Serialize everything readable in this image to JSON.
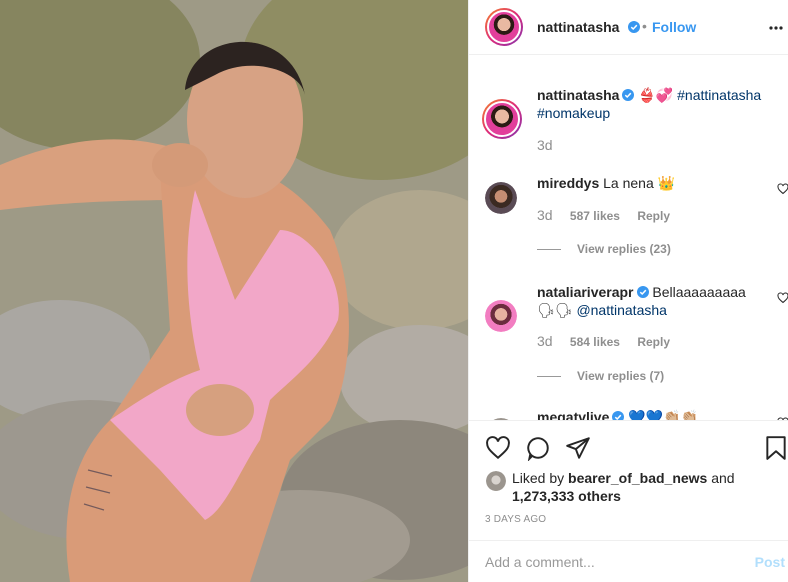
{
  "post": {
    "image_alt": "",
    "author": {
      "username": "nattinatasha",
      "verified": true,
      "follow_label": "Follow",
      "separator": "•"
    }
  },
  "caption": {
    "username": "nattinatasha",
    "emoji": "👙💞",
    "hashtag1": "#nattinatasha",
    "hashtag2": "#nomakeup",
    "time": "3d"
  },
  "comments": [
    {
      "username": "mireddys",
      "text": "La nena 👑",
      "time": "3d",
      "likes": "587 likes",
      "reply": "Reply",
      "view_replies": "View replies (23)"
    },
    {
      "username": "nataliariverapr",
      "verified": true,
      "text": "Bellaaaaaaaaa",
      "text2_emoji": "🗣🗣",
      "mention": "@nattinatasha",
      "time": "3d",
      "likes": "584 likes",
      "reply": "Reply",
      "view_replies": "View replies (7)"
    },
    {
      "username": "megatvlive",
      "verified": true,
      "text": "💙💙👏🏼👏🏼"
    }
  ],
  "likes": {
    "prefix": "Liked by ",
    "user": "bearer_of_bad_news",
    "mid": " and",
    "count": "1,273,333 others"
  },
  "post_date": "3 DAYS AGO",
  "add_comment": {
    "placeholder": "Add a comment...",
    "post_label": "Post"
  },
  "colors": {
    "link": "#3897f0",
    "hashtag": "#003569",
    "swimsuit": "#f2a7c8"
  }
}
